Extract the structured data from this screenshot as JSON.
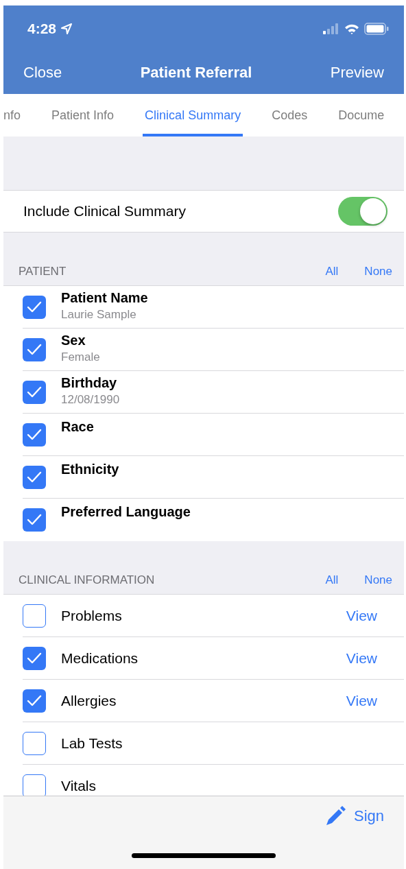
{
  "status_bar": {
    "time": "4:28"
  },
  "nav_bar": {
    "left": "Close",
    "title": "Patient Referral",
    "right": "Preview"
  },
  "tabs": [
    {
      "label": "nfo",
      "selected": false
    },
    {
      "label": "Patient Info",
      "selected": false
    },
    {
      "label": "Clinical Summary",
      "selected": true
    },
    {
      "label": "Codes",
      "selected": false
    },
    {
      "label": "Docume",
      "selected": false
    }
  ],
  "include_row": {
    "label": "Include Clinical Summary",
    "on": true
  },
  "sections": [
    {
      "title": "PATIENT",
      "all": "All",
      "none": "None",
      "items": [
        {
          "label": "Patient Name",
          "detail": "Laurie Sample",
          "checked": true
        },
        {
          "label": "Sex",
          "detail": "Female",
          "checked": true
        },
        {
          "label": "Birthday",
          "detail": "12/08/1990",
          "checked": true
        },
        {
          "label": "Race",
          "checked": true
        },
        {
          "label": "Ethnicity",
          "checked": true
        },
        {
          "label": "Preferred Language",
          "checked": true
        }
      ]
    },
    {
      "title": "CLINICAL INFORMATION",
      "all": "All",
      "none": "None",
      "items": [
        {
          "label": "Problems",
          "checked": false,
          "action": "View"
        },
        {
          "label": "Medications",
          "checked": true,
          "action": "View"
        },
        {
          "label": "Allergies",
          "checked": true,
          "action": "View"
        },
        {
          "label": "Lab Tests",
          "checked": false
        },
        {
          "label": "Vitals",
          "checked": false
        }
      ]
    }
  ],
  "toolbar": {
    "sign": "Sign"
  }
}
